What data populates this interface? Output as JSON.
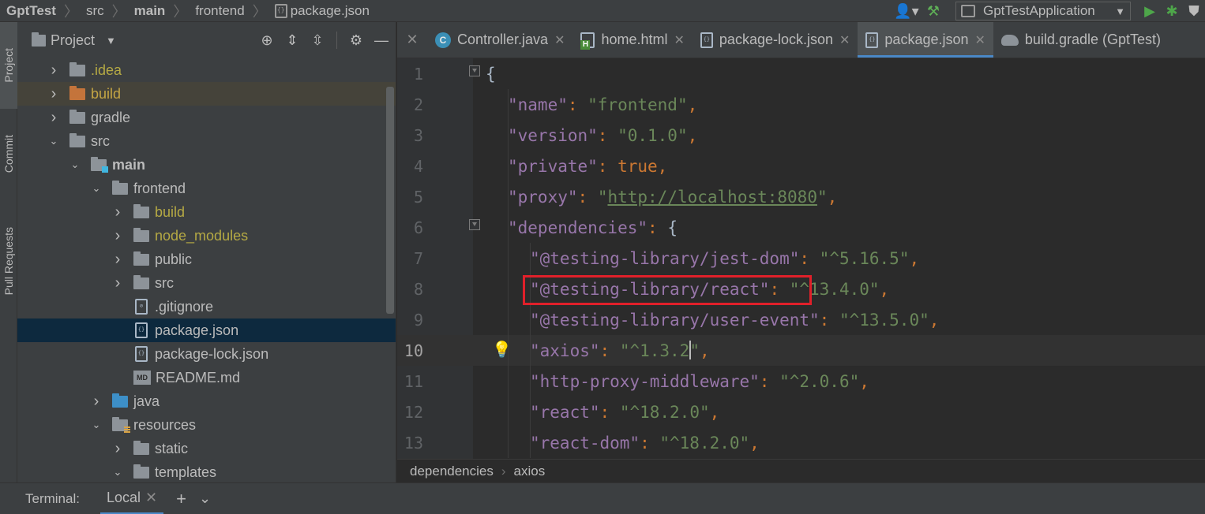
{
  "topbar": {
    "breadcrumbs": [
      "GptTest",
      "src",
      "main",
      "frontend",
      "package.json"
    ],
    "run_config": "GptTestApplication"
  },
  "left_strip": {
    "project": "Project",
    "commit": "Commit",
    "pull_requests": "Pull Requests"
  },
  "project_panel": {
    "title": "Project",
    "tree": [
      {
        "label": ".idea",
        "depth": 0,
        "expanded": false,
        "kind": "folder",
        "style": "yellow"
      },
      {
        "label": "build",
        "depth": 0,
        "expanded": false,
        "kind": "folder-orange",
        "style": "orange"
      },
      {
        "label": "gradle",
        "depth": 0,
        "expanded": false,
        "kind": "folder"
      },
      {
        "label": "src",
        "depth": 0,
        "expanded": true,
        "kind": "folder"
      },
      {
        "label": "main",
        "depth": 1,
        "expanded": true,
        "kind": "folder-module",
        "style": "bold"
      },
      {
        "label": "frontend",
        "depth": 2,
        "expanded": true,
        "kind": "folder"
      },
      {
        "label": "build",
        "depth": 3,
        "expanded": false,
        "kind": "folder",
        "style": "yellow"
      },
      {
        "label": "node_modules",
        "depth": 3,
        "expanded": false,
        "kind": "folder",
        "style": "yellow"
      },
      {
        "label": "public",
        "depth": 3,
        "expanded": false,
        "kind": "folder"
      },
      {
        "label": "src",
        "depth": 3,
        "expanded": false,
        "kind": "folder"
      },
      {
        "label": ".gitignore",
        "depth": 3,
        "kind": "file"
      },
      {
        "label": "package.json",
        "depth": 3,
        "kind": "file-json",
        "selected": true
      },
      {
        "label": "package-lock.json",
        "depth": 3,
        "kind": "file-json"
      },
      {
        "label": "README.md",
        "depth": 3,
        "kind": "file-md"
      },
      {
        "label": "java",
        "depth": 2,
        "expanded": false,
        "kind": "folder-blue"
      },
      {
        "label": "resources",
        "depth": 2,
        "expanded": true,
        "kind": "folder-res"
      },
      {
        "label": "static",
        "depth": 3,
        "expanded": false,
        "kind": "folder"
      },
      {
        "label": "templates",
        "depth": 3,
        "expanded": true,
        "kind": "folder"
      }
    ]
  },
  "editor": {
    "tabs": [
      {
        "label": "Controller.java",
        "icon": "class-icon"
      },
      {
        "label": "home.html",
        "icon": "html-icon"
      },
      {
        "label": "package-lock.json",
        "icon": "json-icon"
      },
      {
        "label": "package.json",
        "icon": "json-icon",
        "active": true
      },
      {
        "label": "build.gradle (GptTest)",
        "icon": "gradle-icon"
      }
    ],
    "current_line": 10,
    "lines": [
      {
        "n": "1",
        "tokens": [
          [
            "brace",
            "{"
          ]
        ]
      },
      {
        "n": "2",
        "tokens": [
          [
            "key",
            "\"name\""
          ],
          [
            "punc",
            ": "
          ],
          [
            "str",
            "\"frontend\""
          ],
          [
            "punc",
            ","
          ]
        ]
      },
      {
        "n": "3",
        "tokens": [
          [
            "key",
            "\"version\""
          ],
          [
            "punc",
            ": "
          ],
          [
            "str",
            "\"0.1.0\""
          ],
          [
            "punc",
            ","
          ]
        ]
      },
      {
        "n": "4",
        "tokens": [
          [
            "key",
            "\"private\""
          ],
          [
            "punc",
            ": "
          ],
          [
            "kw",
            "true"
          ],
          [
            "punc",
            ","
          ]
        ]
      },
      {
        "n": "5",
        "tokens": [
          [
            "key",
            "\"proxy\""
          ],
          [
            "punc",
            ": "
          ],
          [
            "str",
            "\""
          ],
          [
            "url",
            "http://localhost:8080"
          ],
          [
            "str",
            "\""
          ],
          [
            "punc",
            ","
          ]
        ]
      },
      {
        "n": "6",
        "tokens": [
          [
            "key",
            "\"dependencies\""
          ],
          [
            "punc",
            ": "
          ],
          [
            "brace",
            "{"
          ]
        ]
      },
      {
        "n": "7",
        "tokens": [
          [
            "key",
            "\"@testing-library/jest-dom\""
          ],
          [
            "punc",
            ": "
          ],
          [
            "str",
            "\"^5.16.5\""
          ],
          [
            "punc",
            ","
          ]
        ]
      },
      {
        "n": "8",
        "tokens": [
          [
            "key",
            "\"@testing-library/react\""
          ],
          [
            "punc",
            ": "
          ],
          [
            "str",
            "\"^13.4.0\""
          ],
          [
            "punc",
            ","
          ]
        ]
      },
      {
        "n": "9",
        "tokens": [
          [
            "key",
            "\"@testing-library/user-event\""
          ],
          [
            "punc",
            ": "
          ],
          [
            "str",
            "\"^13.5.0\""
          ],
          [
            "punc",
            ","
          ]
        ]
      },
      {
        "n": "10",
        "tokens": [
          [
            "key",
            "\"axios\""
          ],
          [
            "punc",
            ": "
          ],
          [
            "str",
            "\"^1.3.2\""
          ],
          [
            "punc",
            ","
          ]
        ]
      },
      {
        "n": "11",
        "tokens": [
          [
            "key",
            "\"http-proxy-middleware\""
          ],
          [
            "punc",
            ": "
          ],
          [
            "str",
            "\"^2.0.6\""
          ],
          [
            "punc",
            ","
          ]
        ]
      },
      {
        "n": "12",
        "tokens": [
          [
            "key",
            "\"react\""
          ],
          [
            "punc",
            ": "
          ],
          [
            "str",
            "\"^18.2.0\""
          ],
          [
            "punc",
            ","
          ]
        ]
      },
      {
        "n": "13",
        "tokens": [
          [
            "key",
            "\"react-dom\""
          ],
          [
            "punc",
            ": "
          ],
          [
            "str",
            "\"^18.2.0\""
          ],
          [
            "punc",
            ","
          ]
        ]
      }
    ]
  },
  "breadcrumb": [
    "dependencies",
    "axios"
  ],
  "terminal": {
    "title": "Terminal:",
    "tab": "Local"
  }
}
